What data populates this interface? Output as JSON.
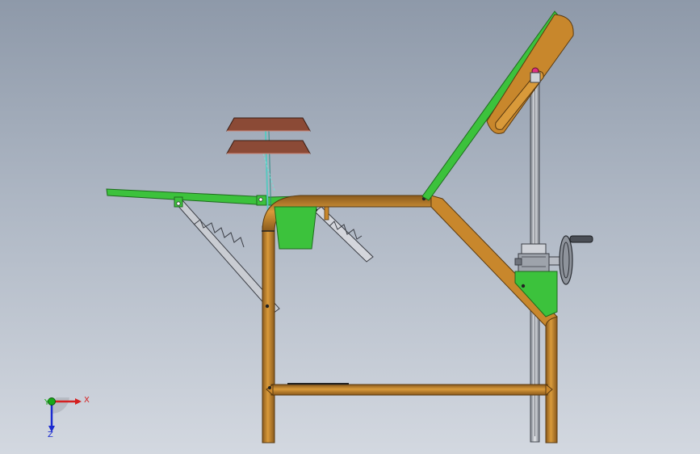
{
  "triad": {
    "x_label": "X",
    "y_label": "Y",
    "z_label": "Z",
    "x_color": "#d42020",
    "y_color": "#18a818",
    "z_color": "#1a2ad0"
  },
  "colors": {
    "frame_tube": "#c8872c",
    "frame_edge": "#5a3a10",
    "panel_green": "#3cc23c",
    "cushion_brown": "#8b4a36",
    "rod_cyan": "#58c8c0",
    "screw_gray": "#b8bcc4"
  }
}
